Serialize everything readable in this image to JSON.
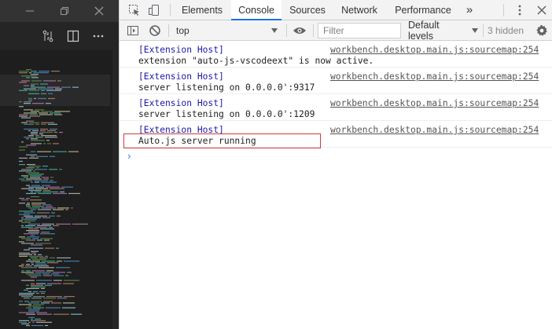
{
  "colors": {
    "editor_bg": "#1e1e1e",
    "devtools_accent": "#1a73e8",
    "message_tag": "#1a1aa6",
    "highlight_box": "#d23a3a"
  },
  "editor": {
    "titlebar_icons": [
      "minimize-icon",
      "restore-icon",
      "close-icon"
    ],
    "toolbar_icons": [
      "compare-changes-icon",
      "split-editor-icon",
      "more-actions-icon"
    ],
    "minimap_present": true
  },
  "devtools": {
    "toolbar_icons": [
      "inspect-element-icon",
      "device-toolbar-icon"
    ],
    "tabs": [
      {
        "label": "Elements",
        "active": false
      },
      {
        "label": "Console",
        "active": true
      },
      {
        "label": "Sources",
        "active": false
      },
      {
        "label": "Network",
        "active": false
      },
      {
        "label": "Performance",
        "active": false
      }
    ],
    "more_tabs": "»",
    "console_toolbar": {
      "context": "top",
      "filter_placeholder": "Filter",
      "levels": "Default levels",
      "hidden": "3 hidden"
    },
    "messages": [
      {
        "tag": "[Extension Host]",
        "text": "extension \"auto-js-vscodeext\" is now active.",
        "source": "workbench.desktop.main.js:sourcemap:254"
      },
      {
        "tag": "[Extension Host]",
        "text": "server listening on 0.0.0.0':9317",
        "source": "workbench.desktop.main.js:sourcemap:254"
      },
      {
        "tag": "[Extension Host]",
        "text": "server listening on 0.0.0.0':1209",
        "source": "workbench.desktop.main.js:sourcemap:254"
      },
      {
        "tag": "[Extension Host]",
        "text": "Auto.js server running",
        "source": "workbench.desktop.main.js:sourcemap:254"
      }
    ],
    "prompt_symbol": "›"
  }
}
